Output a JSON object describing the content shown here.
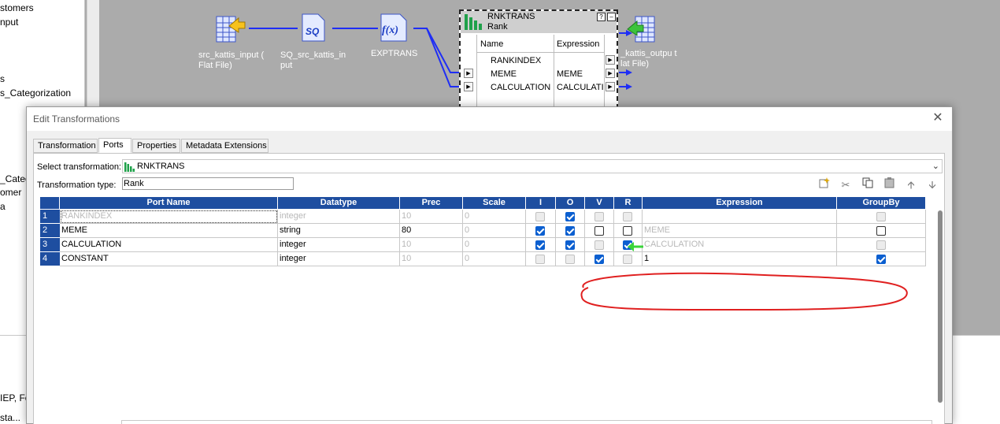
{
  "navigator": {
    "items": [
      "stomers",
      "nput",
      "s",
      "s_Categorization",
      "_Categ",
      "omer",
      "a"
    ]
  },
  "bottom_panel": {
    "lines": [
      "IEP, Fo",
      "sta..."
    ]
  },
  "mapping": {
    "objects": [
      {
        "name": "src_kattis_input (Flat File)",
        "line1": "src_kattis_input (",
        "line2": "Flat File)",
        "icon": "flat-file-source-icon"
      },
      {
        "name": "SQ_src_kattis_input",
        "line1": "SQ_src_kattis_in",
        "line2": "put",
        "icon": "source-qualifier-icon",
        "icon_text": "SQ"
      },
      {
        "name": "EXPTRANS",
        "line1": "EXPTRANS",
        "line2": "",
        "icon": "expression-icon",
        "icon_text": "f(x)"
      },
      {
        "name": "kattis_output (Flat File)",
        "line1": "_kattis_outpu t",
        "line2": "lat File)",
        "icon": "flat-file-target-icon"
      }
    ],
    "rank_box": {
      "title": "RNKTRANS",
      "subtitle": "Rank",
      "col_name": "Name",
      "col_expr": "Expression",
      "ports": [
        {
          "name": "RANKINDEX",
          "expr": ""
        },
        {
          "name": "MEME",
          "expr": "MEME"
        },
        {
          "name": "CALCULATION",
          "expr": "CALCULATI"
        }
      ],
      "icon": "rank-transformation-icon"
    }
  },
  "dialog": {
    "title": "Edit Transformations",
    "tabs": [
      "Transformation",
      "Ports",
      "Properties",
      "Metadata Extensions"
    ],
    "active_tab": "Ports",
    "select_label": "Select transformation:",
    "select_value": "RNKTRANS",
    "type_label": "Transformation type:",
    "type_value": "Rank",
    "toolbar_icons": [
      "new-port-icon",
      "cut-icon",
      "copy-icon",
      "paste-icon",
      "move-up-icon",
      "move-down-icon"
    ],
    "grid": {
      "columns": [
        "Port Name",
        "Datatype",
        "Prec",
        "Scale",
        "I",
        "O",
        "V",
        "R",
        "Expression",
        "GroupBy"
      ],
      "rows": [
        {
          "num": "1",
          "port": "RANKINDEX",
          "dtype": "integer",
          "prec": "10",
          "scale": "0",
          "I": "dis",
          "O": "on",
          "V": "dis",
          "R": "dis",
          "expr": "",
          "groupby": "dis",
          "dim": true
        },
        {
          "num": "2",
          "port": "MEME",
          "dtype": "string",
          "prec": "80",
          "scale": "0",
          "I": "on",
          "O": "on",
          "V": "off",
          "R": "off",
          "expr": "MEME",
          "groupby": "off",
          "dim": false
        },
        {
          "num": "3",
          "port": "CALCULATION",
          "dtype": "integer",
          "prec": "10",
          "scale": "0",
          "I": "on",
          "O": "on",
          "V": "dis",
          "R": "on",
          "expr": "CALCULATION",
          "groupby": "dis",
          "dim": false
        },
        {
          "num": "4",
          "port": "CONSTANT",
          "dtype": "integer",
          "prec": "10",
          "scale": "0",
          "I": "dis",
          "O": "dis",
          "V": "on",
          "R": "dis",
          "expr": "1",
          "groupby": "on",
          "dim": false
        }
      ]
    }
  },
  "colors": {
    "grid_header": "#1e4ea0",
    "checkbox_checked": "#0b5fd0",
    "link_line": "#1f2ef5",
    "annotation_red": "#e02020",
    "annotation_green": "#3ad43a"
  }
}
